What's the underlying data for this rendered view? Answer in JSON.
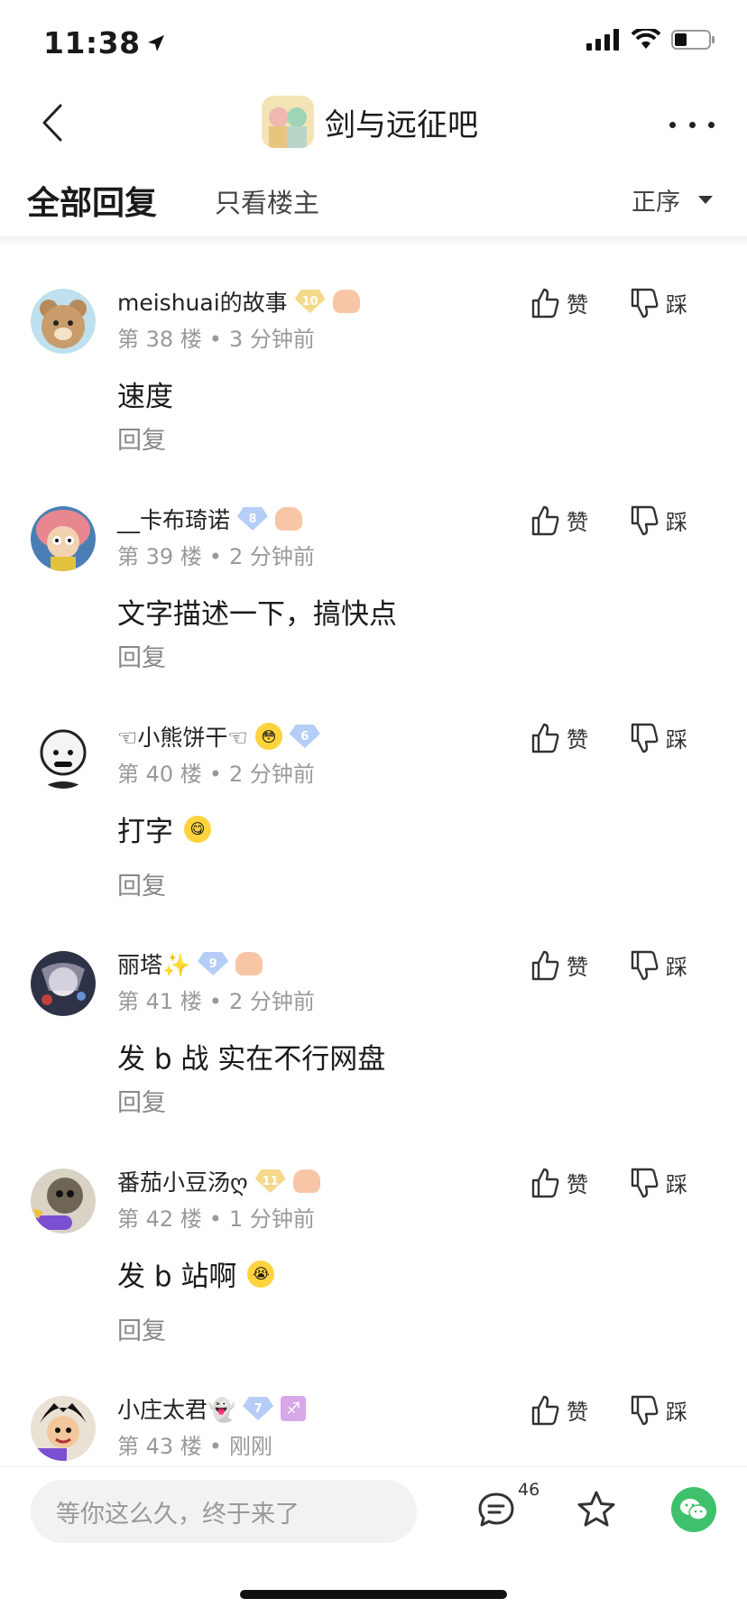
{
  "status": {
    "time": "11:38"
  },
  "nav": {
    "title": "剑与远征吧"
  },
  "tabs": {
    "all": "全部回复",
    "op_only": "只看楼主",
    "sort": "正序"
  },
  "vote_labels": {
    "like": "赞",
    "dislike": "踩"
  },
  "comments": [
    {
      "user": "meishuai的故事",
      "floor": "第 38 楼",
      "time": "3 分钟前",
      "text": "速度",
      "reply": "回复",
      "level": "10",
      "avatar_color": "#d9b88f"
    },
    {
      "user": "__卡布琦诺",
      "floor": "第 39 楼",
      "time": "2 分钟前",
      "text": "文字描述一下，搞快点",
      "reply": "回复",
      "level": "8",
      "avatar_color": "#e89aa6"
    },
    {
      "user": "☜小熊饼干☜",
      "floor": "第 40 楼",
      "time": "2 分钟前",
      "text": "打字",
      "reply": "回复",
      "level": "6",
      "avatar_color": "#dcdcdc"
    },
    {
      "user": "丽塔✨",
      "floor": "第 41 楼",
      "time": "2 分钟前",
      "text": "发 b 战 实在不行网盘",
      "reply": "回复",
      "level": "9",
      "avatar_color": "#3b3f55"
    },
    {
      "user": "番茄小豆汤ღ",
      "floor": "第 42 楼",
      "time": "1 分钟前",
      "text": "发 b 站啊",
      "reply": "回复",
      "level": "11",
      "avatar_color": "#8c8472"
    },
    {
      "user": "小庄太君👻",
      "floor": "第 43 楼",
      "time": "刚刚",
      "level": "7",
      "avatar_color": "#2a2a2a"
    }
  ],
  "bottom": {
    "input_placeholder": "等你这么久，终于来了",
    "comment_count": "46"
  }
}
